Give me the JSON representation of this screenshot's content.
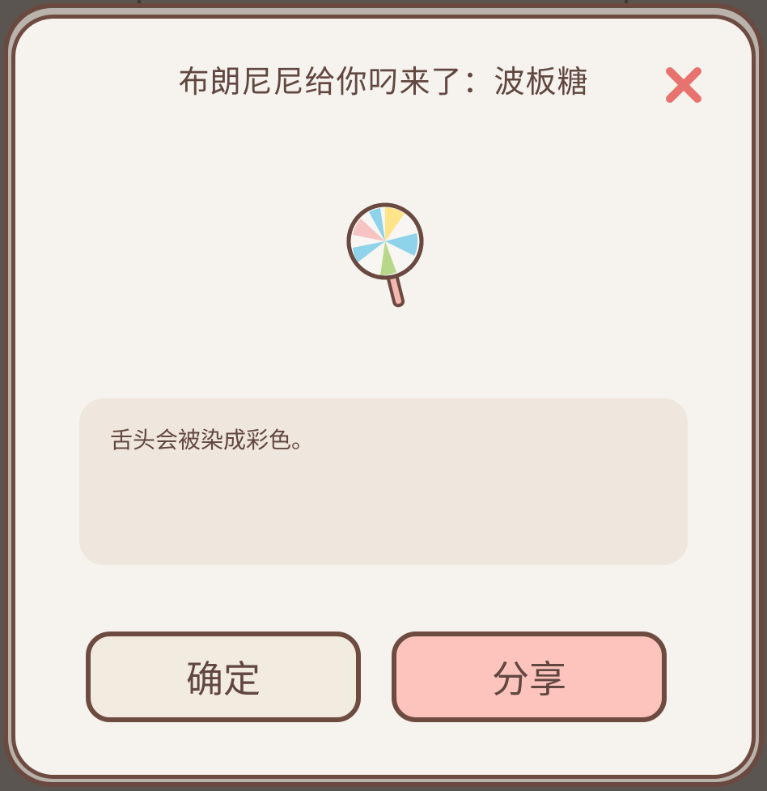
{
  "dialog": {
    "title": "布朗尼尼给你叼来了：波板糖",
    "item_icon": "lollipop-icon",
    "description": "舌头会被染成彩色。",
    "confirm_label": "确定",
    "share_label": "分享",
    "close_icon": "close-icon"
  },
  "colors": {
    "frame_border": "#6e4b40",
    "panel_bg": "#f6f3ee",
    "text": "#614740",
    "close_red": "#e8736e",
    "share_bg": "#fcc4bc",
    "confirm_bg": "#f2ebe0",
    "desc_bg": "#efe7dd"
  }
}
